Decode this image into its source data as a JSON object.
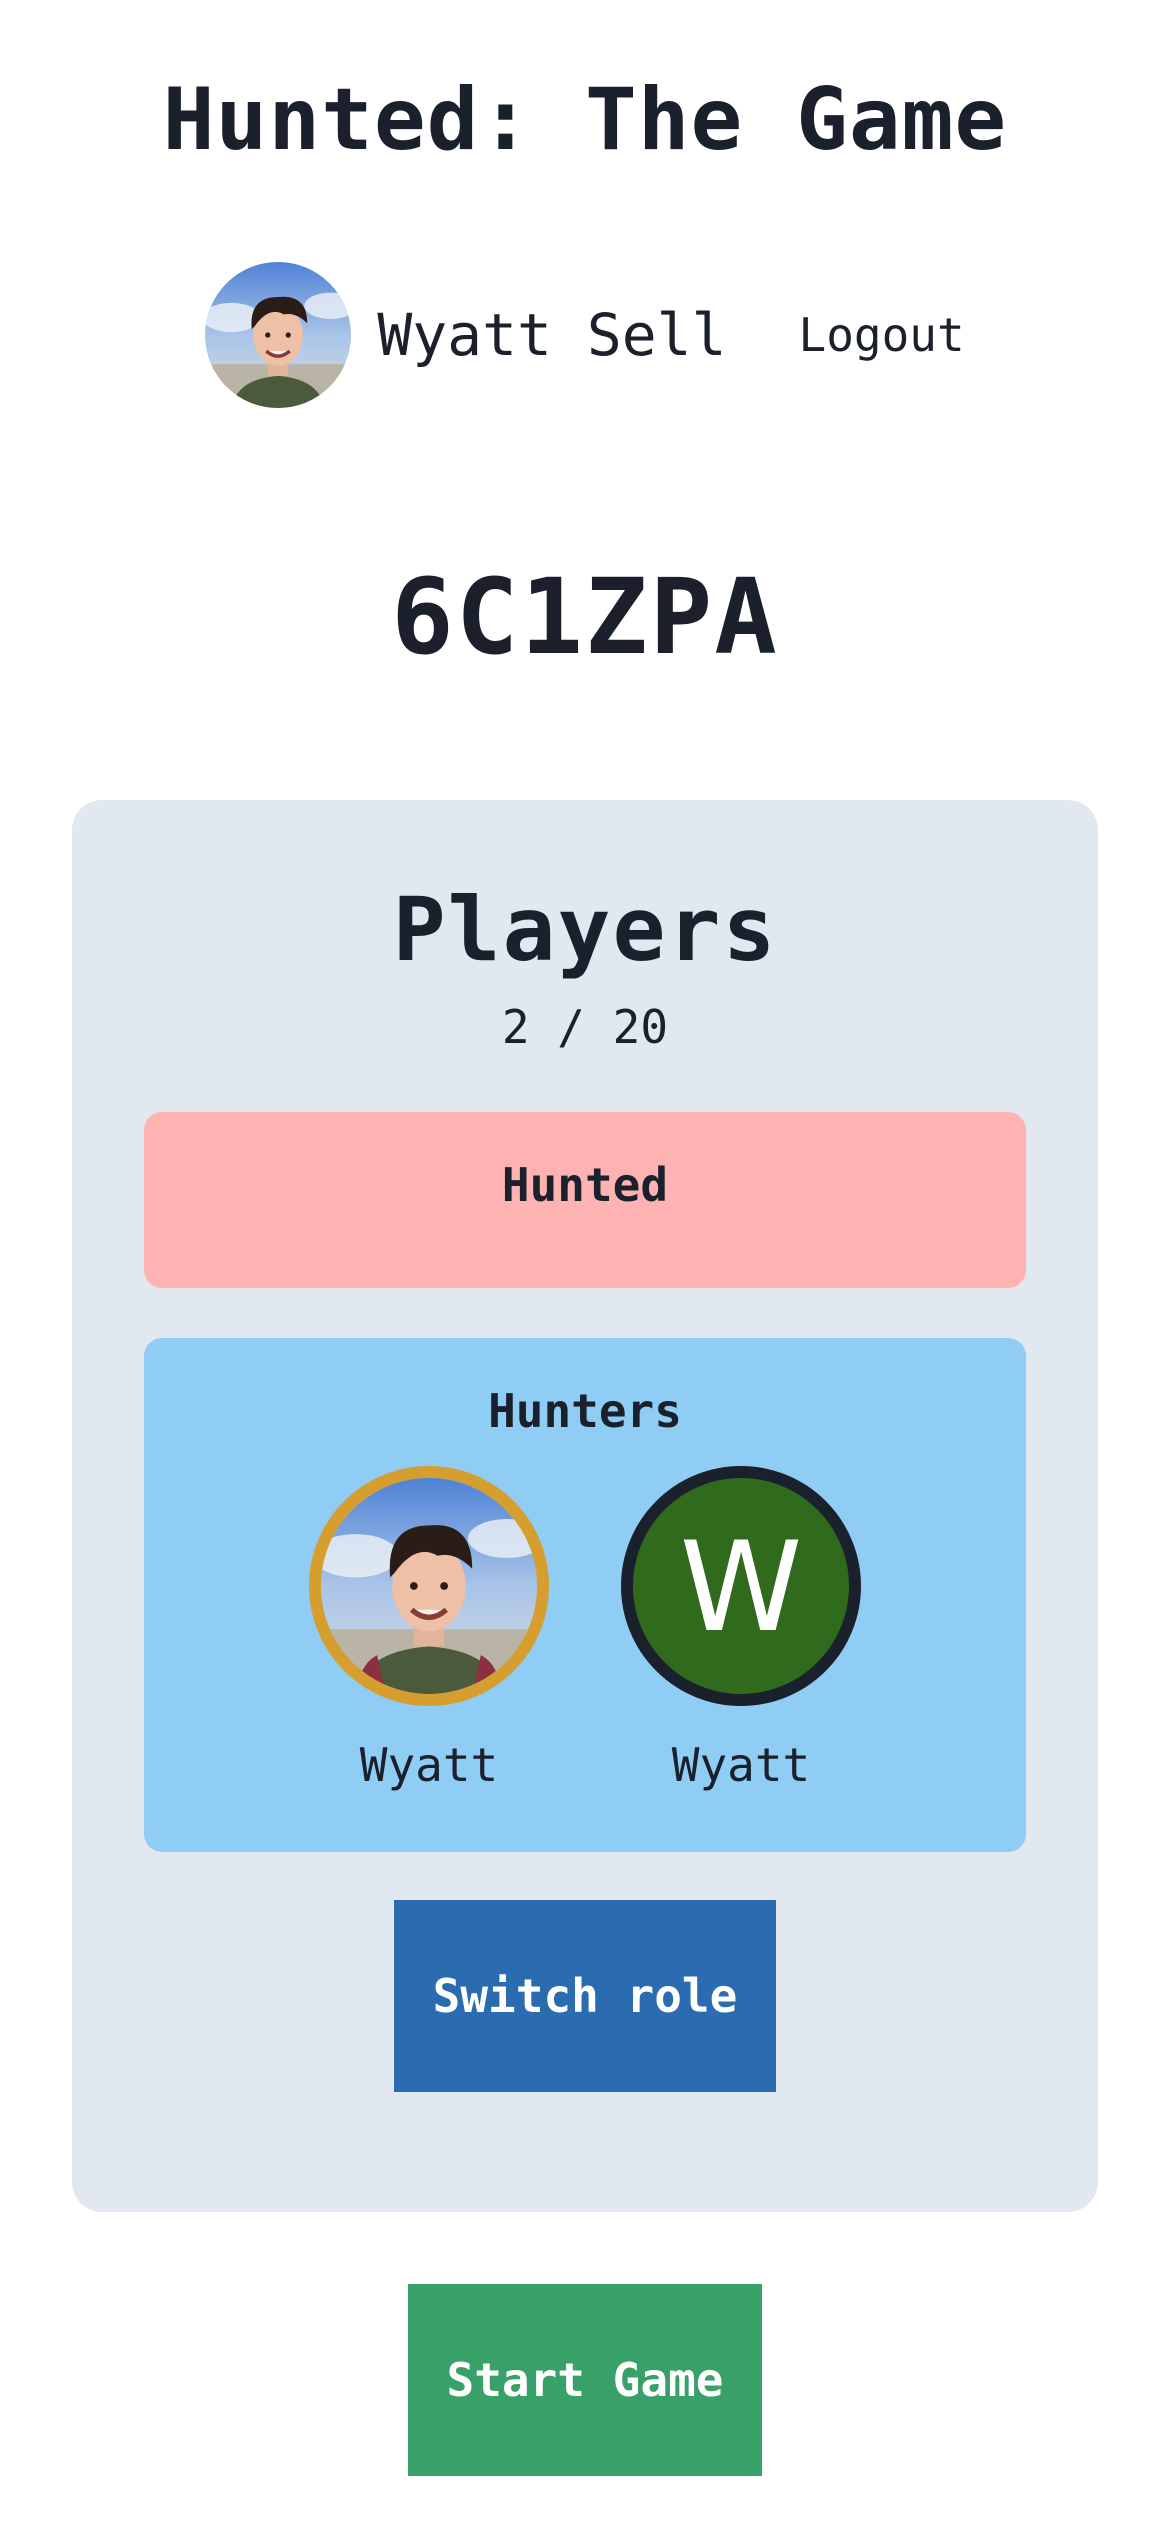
{
  "header": {
    "title": "Hunted: The Game",
    "user_name": "Wyatt Sell",
    "logout_label": "Logout"
  },
  "game": {
    "code": "6C1ZPA"
  },
  "players": {
    "heading": "Players",
    "count": "2 / 20",
    "teams": {
      "hunted": {
        "label": "Hunted"
      },
      "hunters": {
        "label": "Hunters",
        "members": [
          {
            "name": "Wyatt",
            "avatar": "photo",
            "ring_color": "#d69e2e"
          },
          {
            "name": "Wyatt",
            "avatar": "initial",
            "initial": "W",
            "ring_color": "#1a202c",
            "avatar_color": "#2f6a1d"
          }
        ]
      }
    },
    "switch_role_label": "Switch role"
  },
  "actions": {
    "start_game_label": "Start Game"
  },
  "colors": {
    "card_bg": "#e2e8f0",
    "hunted_bg": "#feb2b2",
    "hunters_bg": "#90cdf4",
    "switch_role_bg": "#2b6cb0",
    "start_game_bg": "#38a169"
  }
}
